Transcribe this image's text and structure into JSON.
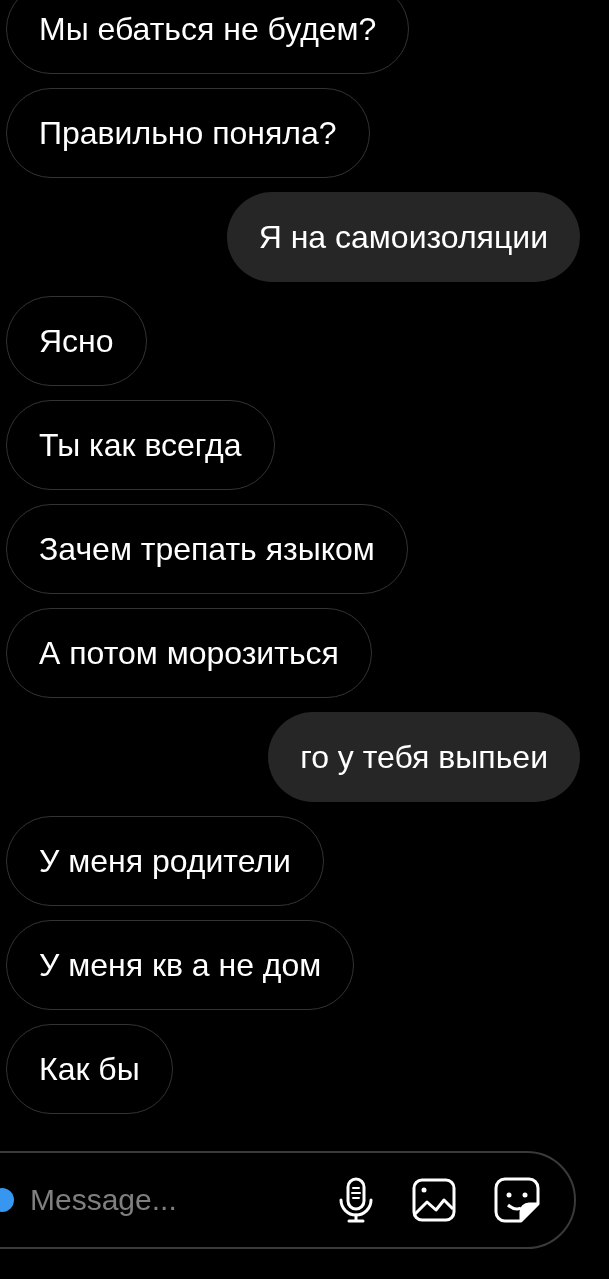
{
  "messages": [
    {
      "kind": "incoming",
      "text": "Мы ебаться не будем?"
    },
    {
      "kind": "incoming",
      "text": "Правильно поняла?"
    },
    {
      "kind": "outgoing",
      "text": "Я на самоизоляции"
    },
    {
      "kind": "incoming",
      "text": "Ясно"
    },
    {
      "kind": "incoming",
      "text": "Ты как всегда"
    },
    {
      "kind": "incoming",
      "text": "Зачем трепать языком"
    },
    {
      "kind": "incoming",
      "text": "А потом морозиться"
    },
    {
      "kind": "outgoing",
      "text": "го у тебя выпьеи"
    },
    {
      "kind": "incoming",
      "text": "У меня родители"
    },
    {
      "kind": "incoming",
      "text": "У меня кв а не дом"
    },
    {
      "kind": "incoming",
      "text": "Как бы"
    }
  ],
  "composer": {
    "placeholder": "Message..."
  }
}
